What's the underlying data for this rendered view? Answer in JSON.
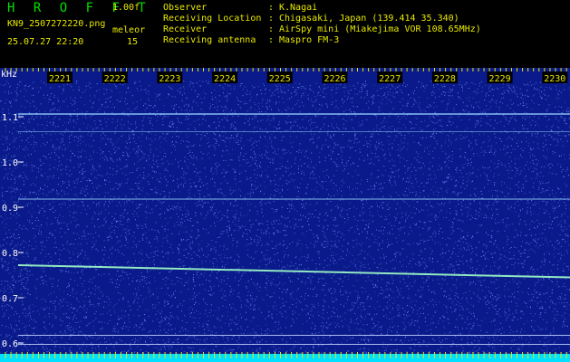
{
  "header": {
    "app_title": "H R O F F T",
    "version": "1.00f",
    "filename": "KN9_2507272220.png",
    "datetime": "25.07.27 22:20",
    "mode": "meleor",
    "count": "15",
    "info": [
      {
        "label": "Observer",
        "value": "K.Nagai"
      },
      {
        "label": "Receiving Location",
        "value": "Chigasaki, Japan (139.414 35.340)"
      },
      {
        "label": "Receiver",
        "value": "AirSpy mini (Miakejima VOR 108.65MHz)"
      },
      {
        "label": "Receiving antenna",
        "value": "Maspro FM-3"
      }
    ],
    "colon": ":"
  },
  "chart_data": {
    "type": "heatmap",
    "ylabel": "kHz",
    "x_ticks": [
      "2221",
      "2222",
      "2223",
      "2224",
      "2225",
      "2226",
      "2227",
      "2228",
      "2229",
      "2230"
    ],
    "y_ticks": [
      "1.1",
      "1.0",
      "0.9",
      "0.8",
      "0.7",
      "0.6"
    ],
    "ylim": [
      0.58,
      1.18
    ],
    "horizontal_lines_khz": [
      1.106,
      1.067,
      0.918,
      0.617,
      0.597
    ],
    "drifting_signal": {
      "start_khz": 0.772,
      "end_khz": 0.745
    },
    "colors": {
      "background": "#0a1a8a",
      "noise": "#6c8cff",
      "signal": "#a0ffc8",
      "band": "#00e0ff",
      "tick": "#e8e800"
    }
  }
}
